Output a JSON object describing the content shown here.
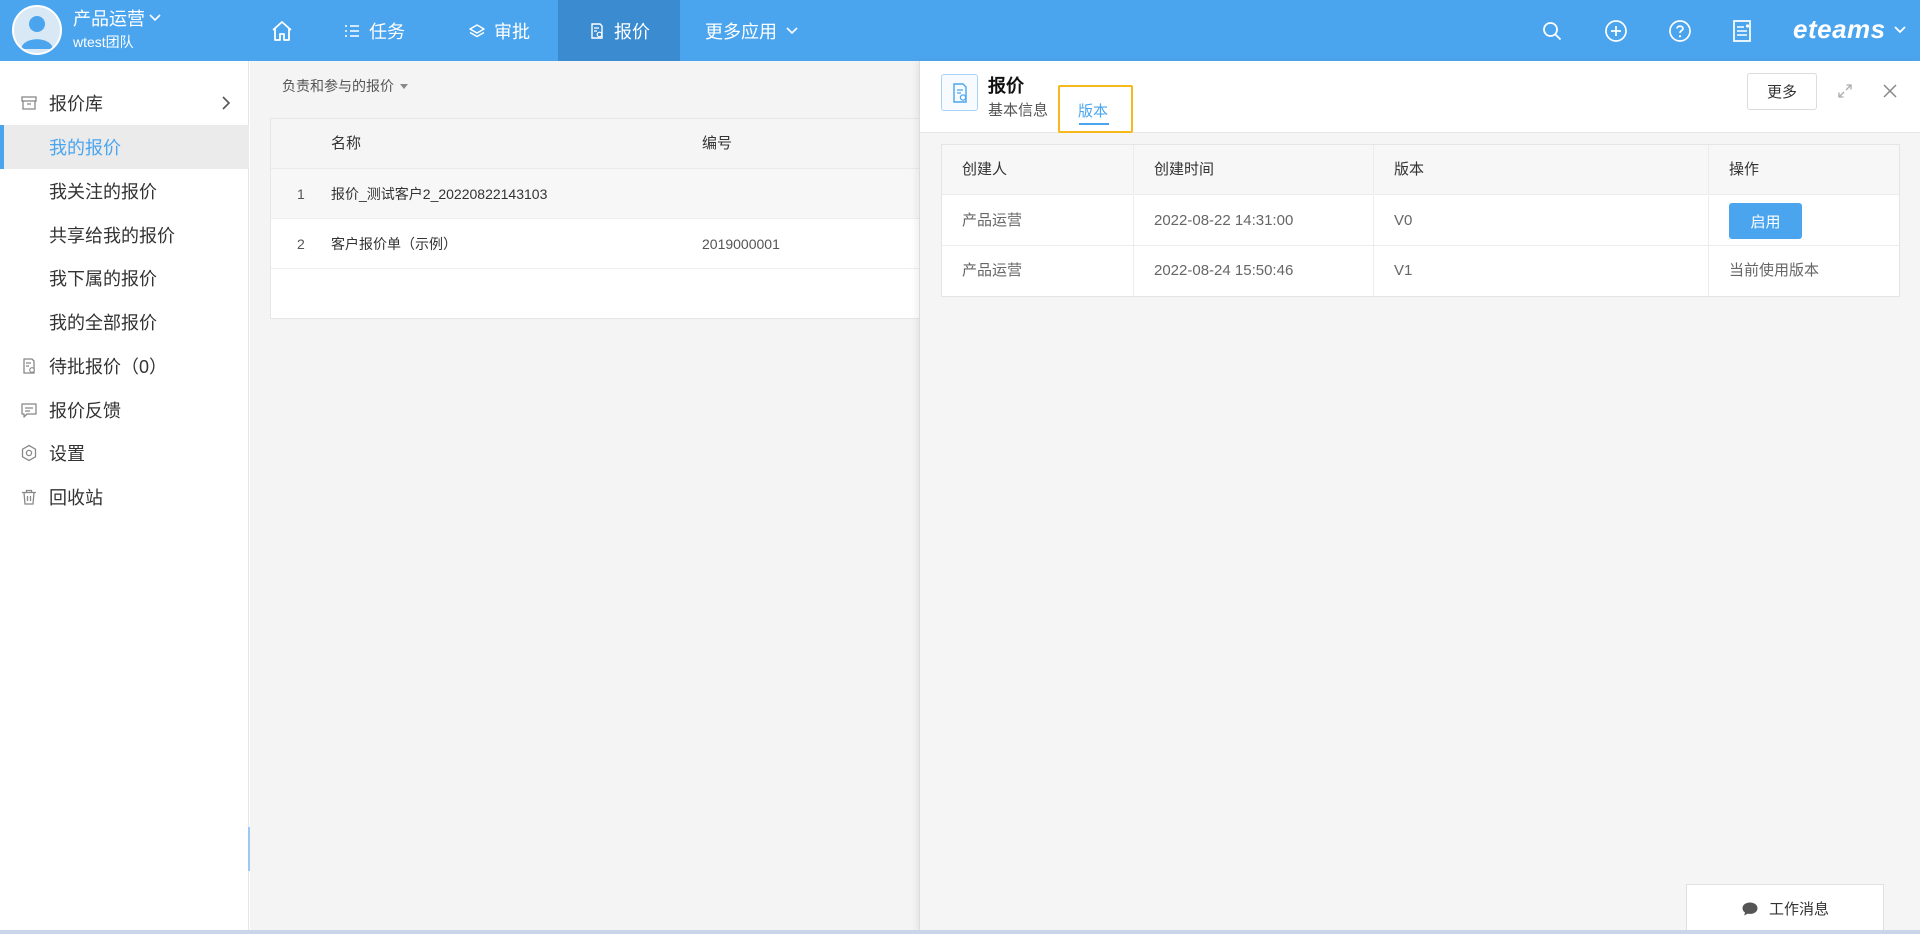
{
  "header": {
    "user_name": "产品运营",
    "team": "wtest团队",
    "nav": [
      {
        "label": "任务"
      },
      {
        "label": "审批"
      },
      {
        "label": "报价"
      },
      {
        "label": "更多应用"
      }
    ],
    "brand": "eteams",
    "accent_color": "#4ba5ee"
  },
  "sidebar": {
    "items": [
      {
        "label": "报价库",
        "icon": "archive-icon"
      },
      {
        "label": "我的报价"
      },
      {
        "label": "我关注的报价"
      },
      {
        "label": "共享给我的报价"
      },
      {
        "label": "我下属的报价"
      },
      {
        "label": "我的全部报价"
      },
      {
        "label": "待批报价（0）",
        "icon": "pending-doc-icon"
      },
      {
        "label": "报价反馈",
        "icon": "feedback-icon"
      },
      {
        "label": "设置",
        "icon": "settings-icon"
      },
      {
        "label": "回收站",
        "icon": "trash-icon"
      }
    ]
  },
  "list": {
    "filter_label": "负责和参与的报价",
    "columns": {
      "name": "名称",
      "code": "编号"
    },
    "rows": [
      {
        "num": "1",
        "name": "报价_测试客户2_20220822143103",
        "code": ""
      },
      {
        "num": "2",
        "name": "客户报价单（示例）",
        "code": "2019000001"
      }
    ]
  },
  "panel": {
    "title": "报价",
    "tabs": {
      "basic": "基本信息",
      "version": "版本"
    },
    "more_label": "更多",
    "columns": {
      "creator": "创建人",
      "created_at": "创建时间",
      "version": "版本",
      "action": "操作"
    },
    "rows": [
      {
        "creator": "产品运营",
        "created_at": "2022-08-22 14:31:00",
        "version": "V0",
        "action": "启用"
      },
      {
        "creator": "产品运营",
        "created_at": "2022-08-24 15:50:46",
        "version": "V1",
        "action": "当前使用版本"
      }
    ]
  },
  "footer": {
    "work_message": "工作消息"
  }
}
